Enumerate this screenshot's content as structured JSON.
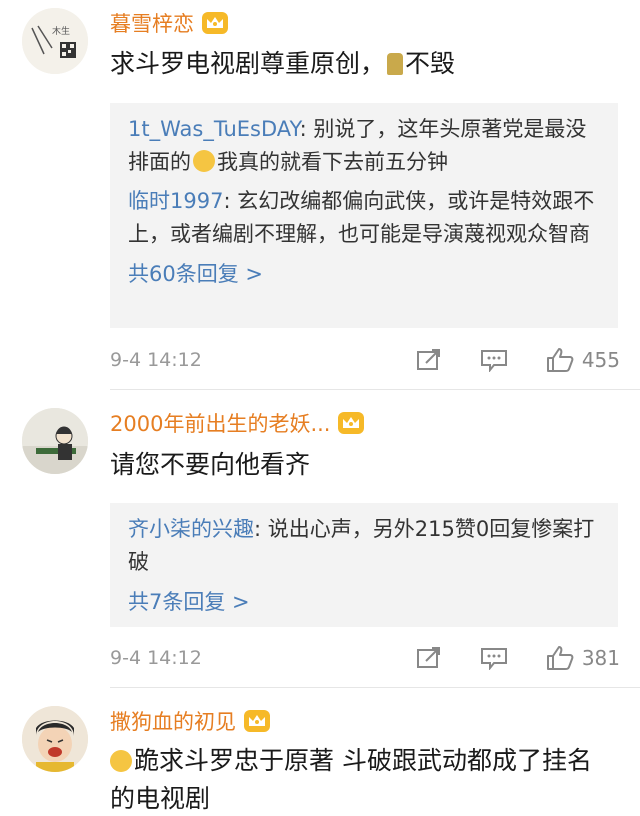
{
  "comments": [
    {
      "username": "暮雪梓恋",
      "text_before": "求斗罗电视剧尊重原创，",
      "text_after": "不毁",
      "replies": [
        {
          "name": "1t_Was_TuEsDAY",
          "sep": ":",
          "text_a": " 别说了，这年头原著党是最没排面的",
          "text_b": "我真的就看下去前五分钟"
        },
        {
          "name": "临时1997",
          "sep": ":",
          "text": " 玄幻改编都偏向武侠，或许是特效跟不上，或者编剧不理解，也可能是导演蔑视观众智商"
        }
      ],
      "more": "共60条回复 >",
      "time": "9-4 14:12",
      "likes": "455",
      "avatar_icon": "qr-code-avatar"
    },
    {
      "username": "2000年前出生的老妖...",
      "text": "请您不要向他看齐",
      "replies": [
        {
          "name": "齐小柒的兴趣",
          "sep": ":",
          "text": " 说出心声，另外215赞0回复惨案打破"
        }
      ],
      "more": "共7条回复 >",
      "time": "9-4 14:12",
      "likes": "381",
      "avatar_icon": "cartoon-avatar"
    },
    {
      "username": "撒狗血的初见",
      "text": "跪求斗罗忠于原著 斗破跟武动都成了挂名的电视剧",
      "avatar_icon": "crying-child-avatar"
    }
  ],
  "colors": {
    "username": "#e67e22",
    "reply_name": "#4a7db8",
    "reply_bg": "#f3f3f3",
    "meta": "#999999",
    "crown": "#f6b928"
  }
}
